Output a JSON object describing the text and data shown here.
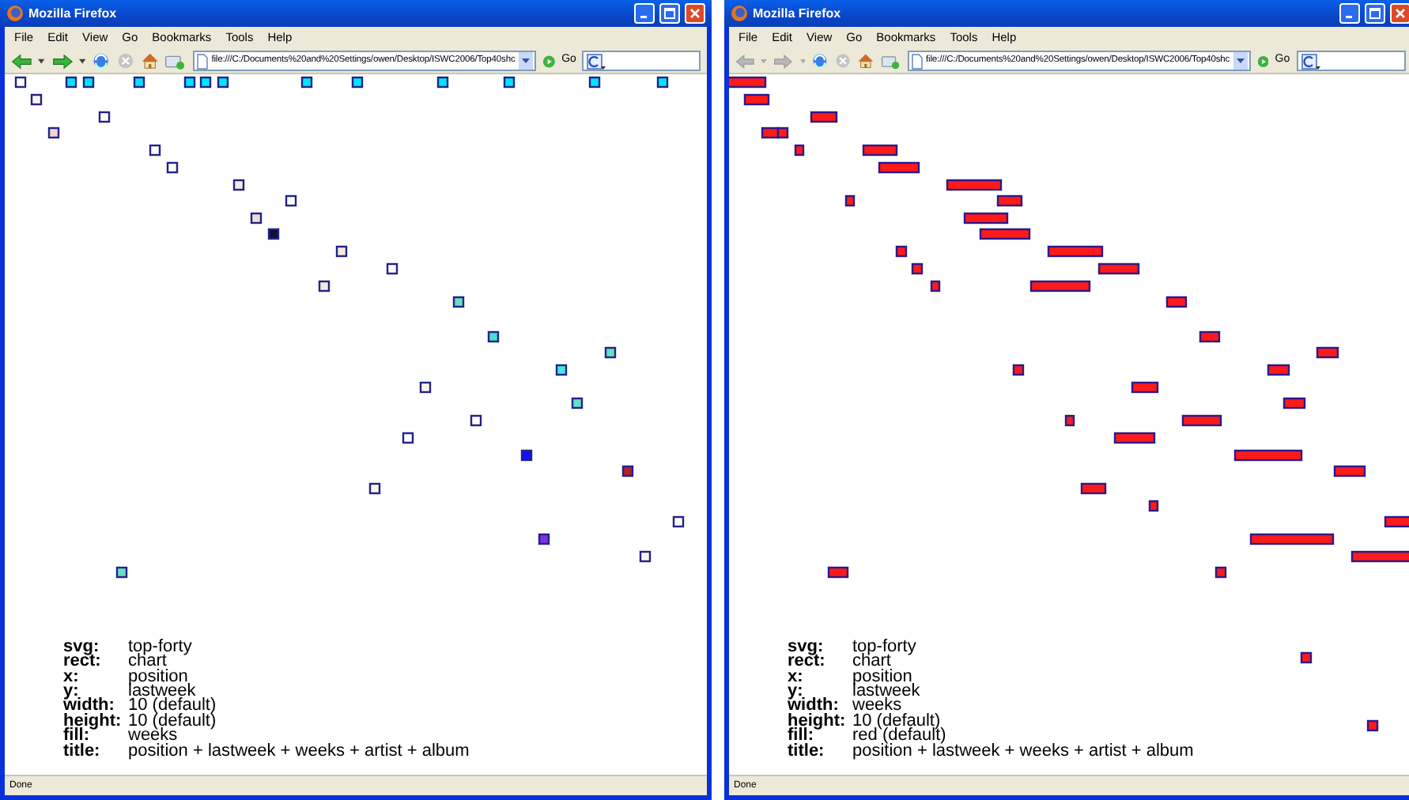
{
  "windows": [
    {
      "title": "Mozilla Firefox",
      "menu": [
        "File",
        "Edit",
        "View",
        "Go",
        "Bookmarks",
        "Tools",
        "Help"
      ],
      "nav_buttons": [
        {
          "kind": "back",
          "disabled": false
        },
        {
          "kind": "forward",
          "disabled": false
        }
      ],
      "address": "file:///C:/Documents%20and%20Settings/owen/Desktop/ISWC2006/Top40shc",
      "go_label": "Go",
      "legend": [
        {
          "key": "svg:",
          "value": "top-forty"
        },
        {
          "key": "rect:",
          "value": "chart"
        },
        {
          "key": "x:",
          "value": "position"
        },
        {
          "key": "y:",
          "value": "lastweek"
        },
        {
          "key": "width:",
          "value": "10 (default)"
        },
        {
          "key": "height:",
          "value": "10 (default)"
        },
        {
          "key": "fill:",
          "value": "weeks"
        },
        {
          "key": "title:",
          "value": "position + lastweek + weeks + artist + album"
        }
      ],
      "status": "Done"
    },
    {
      "title": "Mozilla Firefox",
      "menu": [
        "File",
        "Edit",
        "View",
        "Go",
        "Bookmarks",
        "Tools",
        "Help"
      ],
      "nav_buttons": [
        {
          "kind": "back",
          "disabled": true
        },
        {
          "kind": "forward",
          "disabled": true
        }
      ],
      "address": "file:///C:/Documents%20and%20Settings/owen/Desktop/ISWC2006/Top40shc",
      "go_label": "Go",
      "legend": [
        {
          "key": "svg:",
          "value": "top-forty"
        },
        {
          "key": "rect:",
          "value": "chart"
        },
        {
          "key": "x:",
          "value": "position"
        },
        {
          "key": "y:",
          "value": "lastweek"
        },
        {
          "key": "width:",
          "value": "weeks"
        },
        {
          "key": "height:",
          "value": "10 (default)"
        },
        {
          "key": "fill:",
          "value": "red (default)"
        },
        {
          "key": "title:",
          "value": "position + lastweek + weeks + artist + album"
        }
      ],
      "status": "Done"
    }
  ]
}
